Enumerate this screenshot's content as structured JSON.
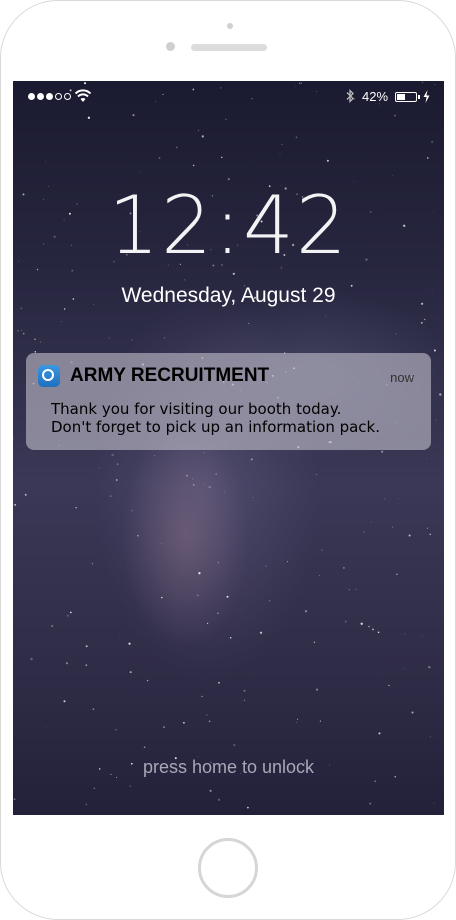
{
  "status_bar": {
    "signal_bars": 5,
    "signal_filled": 3,
    "battery_percent": "42%",
    "battery_level": 0.42
  },
  "lock_screen": {
    "time": "12:42",
    "date": "Wednesday, August 29",
    "unlock_hint": "press home to unlock"
  },
  "notification": {
    "app_name": "ARMY RECRUITMENT",
    "time": "now",
    "line1": "Thank you for visiting our booth today.",
    "line2": "Don't forget to pick up an information pack."
  },
  "colors": {
    "accent_icon": "#2a84d2",
    "text_primary": "#ffffff"
  },
  "icons": {
    "wifi": "wifi-icon",
    "bluetooth": "bluetooth-icon",
    "battery": "battery-icon",
    "charging": "charging-bolt-icon",
    "app": "app-icon"
  }
}
